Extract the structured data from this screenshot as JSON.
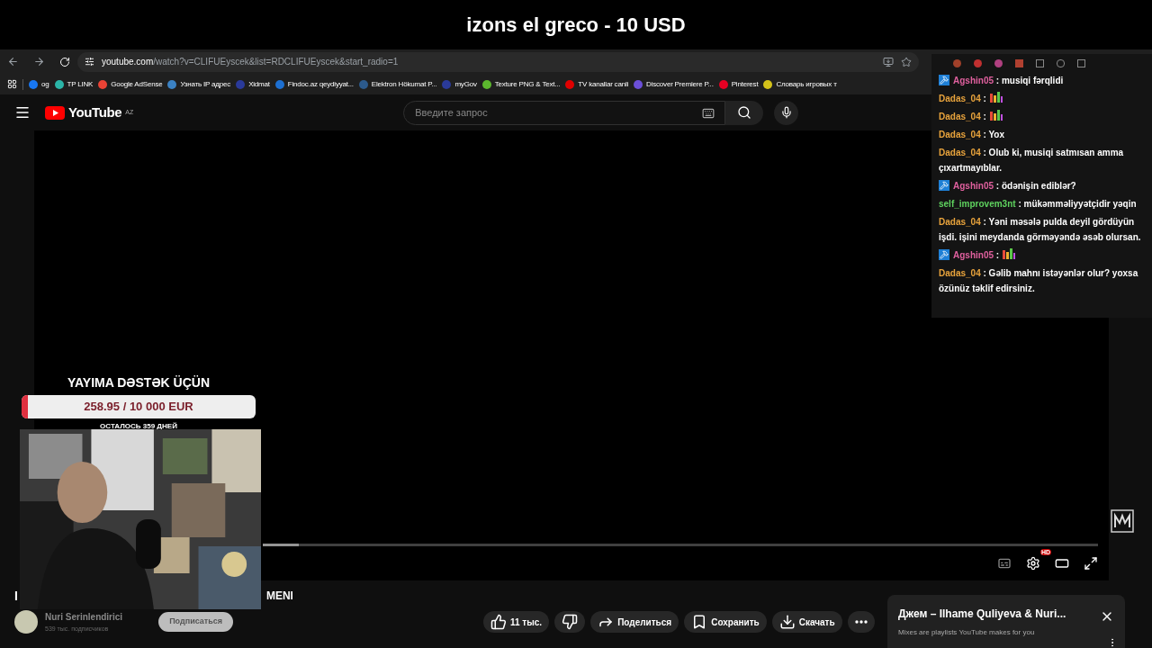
{
  "stream_title": "izons el greco - 10 USD",
  "browser": {
    "url_host": "youtube.com",
    "url_path": "/watch?v=CLIFUEyscek&list=RDCLIFUEyscek&start_radio=1",
    "bookmarks": [
      {
        "label": "og",
        "color": "#1877f2"
      },
      {
        "label": "TP LINK",
        "color": "#2bb5a8"
      },
      {
        "label": "Google AdSense",
        "color": "#ea4335"
      },
      {
        "label": "Узнать IP адрес",
        "color": "#3b82c4"
      },
      {
        "label": "Xidmat",
        "color": "#2a3a9a"
      },
      {
        "label": "Findoc.az qeydiyyat...",
        "color": "#1d6fd1"
      },
      {
        "label": "Elektron Hökumat P...",
        "color": "#2c5a8c"
      },
      {
        "label": "myGov",
        "color": "#2a3a9a"
      },
      {
        "label": "Texture PNG & Text...",
        "color": "#5cb82e"
      },
      {
        "label": "TV kanallar canli",
        "color": "#e00000"
      },
      {
        "label": "Discover Premiere P...",
        "color": "#6b4fd8"
      },
      {
        "label": "Pinterest",
        "color": "#e60023"
      },
      {
        "label": "Словарь игровых т",
        "color": "#d4c21a"
      }
    ]
  },
  "youtube": {
    "logo_text": "YouTube",
    "region": "AZ",
    "search": {
      "placeholder": "Введите запрос"
    }
  },
  "player": {
    "settings_badge": "HD"
  },
  "video": {
    "title_start": "I",
    "title_end": "MENI",
    "channel": "Nuri Serinlendirici",
    "subscribers": "539 тыс. подписчиков",
    "subscribe": "Подписаться",
    "actions": [
      {
        "kind": "like",
        "label": "11 тыс."
      },
      {
        "kind": "dislike"
      },
      {
        "kind": "share",
        "label": "Поделиться"
      },
      {
        "kind": "save",
        "label": "Сохранить"
      },
      {
        "kind": "download",
        "label": "Скачать"
      },
      {
        "kind": "more"
      }
    ]
  },
  "mix": {
    "title": "Джем – Ilhame Quliyeva & Nuri...",
    "subtitle": "Mixes are playlists YouTube makes for you"
  },
  "donation": {
    "title": "YAYIMA DƏSTƏK ÜÇÜN",
    "amount": "258.95 / 10 000 EUR",
    "level": 0.026,
    "remaining": "ОСТАЛОСЬ 359 ДНЕЙ"
  },
  "chat_separator": ":",
  "chat": [
    {
      "user": "Agshin05",
      "color": "#e0609e",
      "badge": true,
      "kind": "text",
      "text": "musiqi fərqlidi"
    },
    {
      "user": "Dadas_04",
      "color": "#e8a33c",
      "badge": false,
      "kind": "emote"
    },
    {
      "user": "Dadas_04",
      "color": "#e8a33c",
      "badge": false,
      "kind": "emote"
    },
    {
      "user": "Dadas_04",
      "color": "#e8a33c",
      "badge": false,
      "kind": "text",
      "text": "Yox"
    },
    {
      "user": "Dadas_04",
      "color": "#e8a33c",
      "badge": false,
      "kind": "text",
      "text": "Olub ki, musiqi satmısan amma çıxartmayıblar."
    },
    {
      "user": "Agshin05",
      "color": "#e0609e",
      "badge": true,
      "kind": "text",
      "text": "ödənişin ediblər?"
    },
    {
      "user": "self_improvem3nt",
      "color": "#5fd35f",
      "badge": false,
      "kind": "text",
      "text": "mükəmməliyyətçidir yəqin"
    },
    {
      "user": "Dadas_04",
      "color": "#e8a33c",
      "badge": false,
      "kind": "text",
      "text": "Yəni məsələ pulda deyil gördüyün işdi. işini meydanda görməyəndə əsəb olursan."
    },
    {
      "user": "Agshin05",
      "color": "#e0609e",
      "badge": true,
      "kind": "emote"
    },
    {
      "user": "Dadas_04",
      "color": "#e8a33c",
      "badge": false,
      "kind": "text",
      "text": "Gəlib mahnı istəyənlər olur? yoxsa özünüz təklif edirsiniz."
    }
  ]
}
